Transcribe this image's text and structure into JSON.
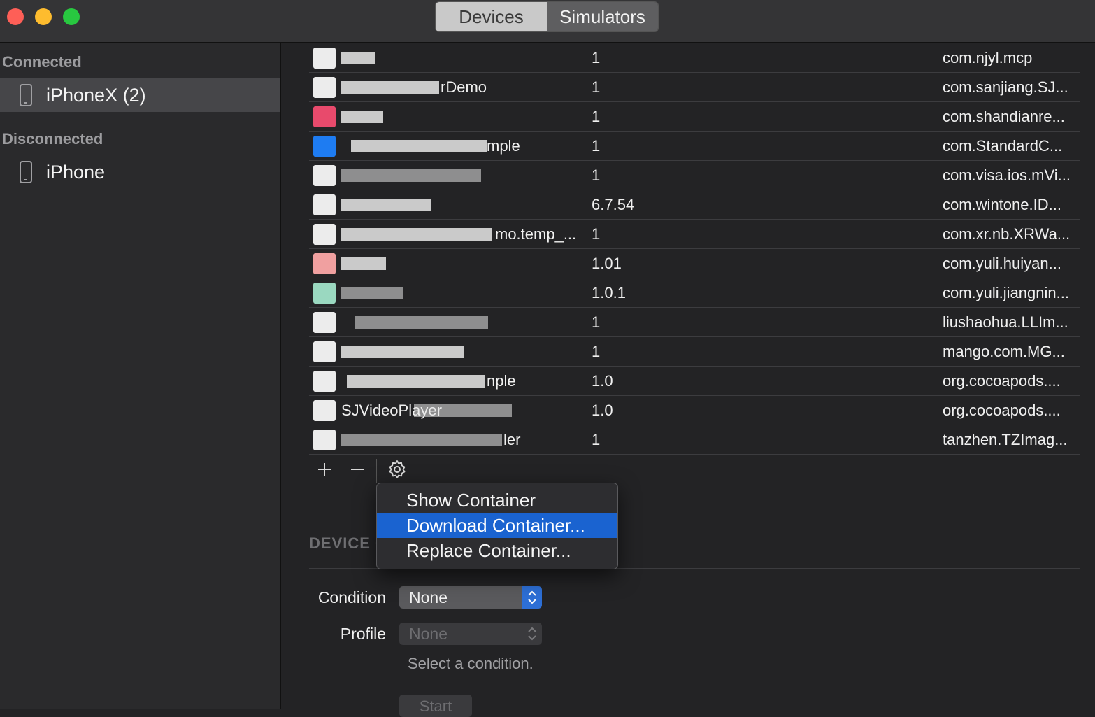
{
  "segmented": {
    "devices": "Devices",
    "simulators": "Simulators"
  },
  "sidebar": {
    "connected_heading": "Connected",
    "disconnected_heading": "Disconnected",
    "connected": [
      {
        "label": "iPhoneX (2)",
        "icon": "iphone-icon"
      }
    ],
    "disconnected": [
      {
        "label": "iPhone",
        "icon": "iphone-icon"
      }
    ]
  },
  "apps": [
    {
      "name": "",
      "version": "1",
      "identifier": "com.njyl.mcp"
    },
    {
      "name": "rDemo",
      "version": "1",
      "identifier": "com.sanjiang.SJ..."
    },
    {
      "name": "",
      "version": "1",
      "identifier": "com.shandianre..."
    },
    {
      "name": "mple",
      "version": "1",
      "identifier": "com.StandardC..."
    },
    {
      "name": "",
      "version": "1",
      "identifier": "com.visa.ios.mVi..."
    },
    {
      "name": "",
      "version": "6.7.54",
      "identifier": "com.wintone.ID..."
    },
    {
      "name": "mo.temp_...",
      "version": "1",
      "identifier": "com.xr.nb.XRWa..."
    },
    {
      "name": "",
      "version": "1.01",
      "identifier": "com.yuli.huiyan..."
    },
    {
      "name": "",
      "version": "1.0.1",
      "identifier": "com.yuli.jiangnin..."
    },
    {
      "name": "",
      "version": "1",
      "identifier": "liushaohua.LLIm..."
    },
    {
      "name": "",
      "version": "1",
      "identifier": "mango.com.MG..."
    },
    {
      "name": "nple",
      "version": "1.0",
      "identifier": "org.cocoapods...."
    },
    {
      "name": "SJVideoPlayer",
      "version": "1.0",
      "identifier": "org.cocoapods...."
    },
    {
      "name": "ler",
      "version": "1",
      "identifier": "tanzhen.TZImag..."
    }
  ],
  "toolbar": {
    "add_icon": "plus-icon",
    "remove_icon": "minus-icon",
    "gear_icon": "gear-icon"
  },
  "context_menu": {
    "items": [
      "Show Container",
      "Download Container...",
      "Replace Container..."
    ],
    "highlighted_index": 1
  },
  "device_section": {
    "title": "DEVICE C",
    "condition_label": "Condition",
    "condition_value": "None",
    "profile_label": "Profile",
    "profile_value": "None",
    "hint": "Select a condition.",
    "start_label": "Start"
  },
  "colors": {
    "accent": "#1a63d0",
    "close": "#fe5f57",
    "minimize": "#febc2e",
    "zoom": "#28c840"
  }
}
